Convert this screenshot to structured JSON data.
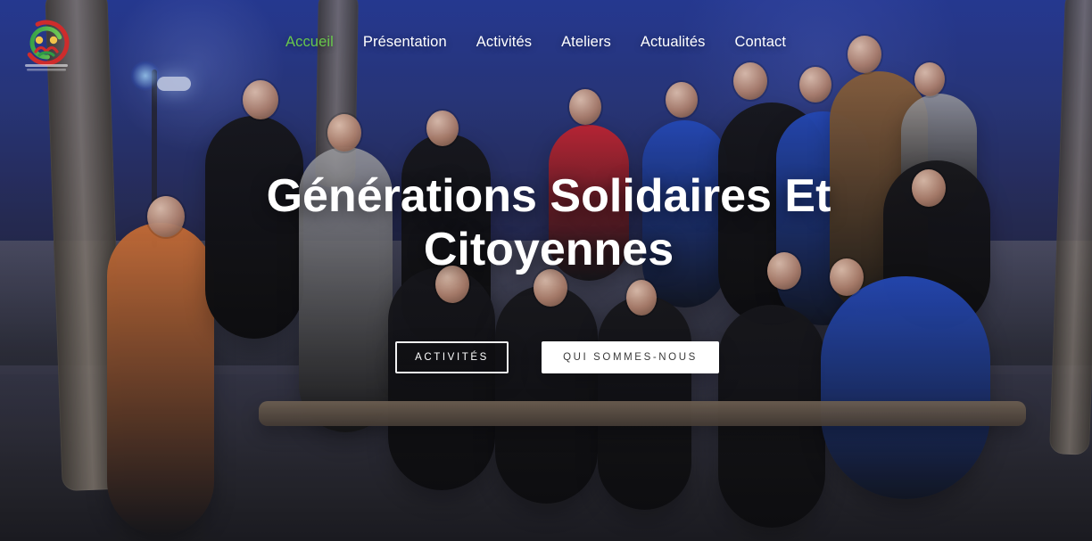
{
  "nav": {
    "items": [
      {
        "label": "Accueil",
        "active": true
      },
      {
        "label": "Présentation",
        "active": false
      },
      {
        "label": "Activités",
        "active": false
      },
      {
        "label": "Ateliers",
        "active": false
      },
      {
        "label": "Actualités",
        "active": false
      },
      {
        "label": "Contact",
        "active": false
      }
    ]
  },
  "hero": {
    "headline": "Générations Solidaires Et Citoyennes",
    "buttons": {
      "primary": "ACTIVITÉS",
      "secondary": "QUI SOMMES-NOUS"
    }
  },
  "colors": {
    "nav_active": "#68c84c",
    "text_primary": "#ffffff",
    "button_solid_bg": "#ffffff",
    "button_solid_text": "#3a3a3a"
  },
  "icons": {
    "logo": "association-logo"
  }
}
